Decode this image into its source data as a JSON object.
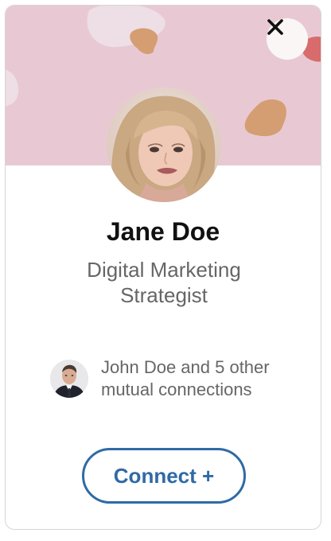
{
  "profile": {
    "name": "Jane Doe",
    "title": "Digital Marketing Strategist"
  },
  "mutual": {
    "text": "John Doe and 5 other mutual connections"
  },
  "actions": {
    "connect_label": "Connect +",
    "close_icon": "close-icon"
  },
  "colors": {
    "banner": "#e8c9d3",
    "accent": "#2f6aa6",
    "secondary_text": "#666666"
  }
}
